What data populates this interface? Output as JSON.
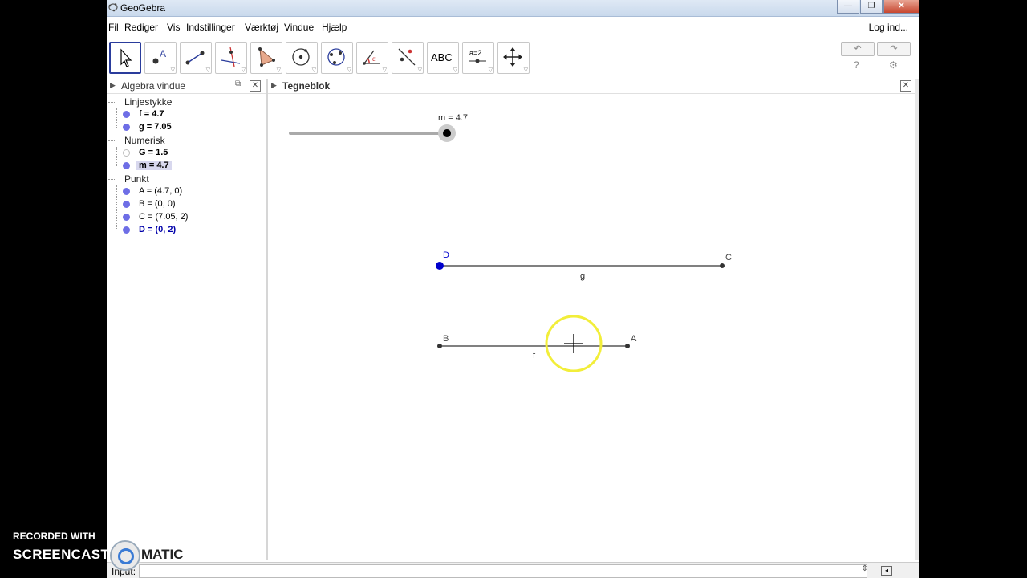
{
  "window": {
    "title": "GeoGebra",
    "min": "—",
    "max": "❐",
    "close": "✕"
  },
  "menu": {
    "items": [
      "Fil",
      "Rediger",
      "Vis",
      "Indstillinger",
      "Værktøj",
      "Vindue",
      "Hjælp"
    ],
    "login": "Log ind..."
  },
  "toolbar": {
    "tools": [
      "move-tool",
      "point-tool",
      "segment-tool",
      "perpendicular-line-tool",
      "polygon-tool",
      "circle-tool",
      "conic-tool",
      "angle-tool",
      "reflect-tool",
      "text-tool",
      "slider-tool",
      "move-graphics-view-tool"
    ],
    "text_tool_label": "ABC",
    "slider_tool_label": "a=2",
    "help_icon": "?",
    "settings_icon": "⚙",
    "undo_icon": "↶",
    "redo_icon": "↷"
  },
  "algebra": {
    "title": "Algebra vindue",
    "groups": [
      {
        "name": "Linjestykke",
        "items": [
          {
            "text": "f = 4.7"
          },
          {
            "text": "g = 7.05"
          }
        ]
      },
      {
        "name": "Numerisk",
        "items": [
          {
            "text": "G = 1.5"
          },
          {
            "text": "m = 4.7"
          }
        ]
      },
      {
        "name": "Punkt",
        "items": [
          {
            "text": "A = (4.7, 0)"
          },
          {
            "text": "B = (0, 0)"
          },
          {
            "text": "C = (7.05, 2)"
          },
          {
            "text": "D = (0, 2)"
          }
        ]
      }
    ]
  },
  "graphics": {
    "title": "Tegneblok",
    "slider_label": "m = 4.7",
    "slider_value": 4.7,
    "points": {
      "A": "A",
      "B": "B",
      "C": "C",
      "D": "D"
    },
    "segments": {
      "f": "f",
      "g": "g"
    }
  },
  "input": {
    "label": "Input:",
    "value": ""
  },
  "watermark": {
    "line1": "RECORDED WITH",
    "line2": "SCREENCAST",
    "line3": "MATIC"
  },
  "colors": {
    "point_blue": "#0000cc",
    "bullet": "#6e6ee6",
    "cursor_highlight": "#f2ee3a"
  }
}
